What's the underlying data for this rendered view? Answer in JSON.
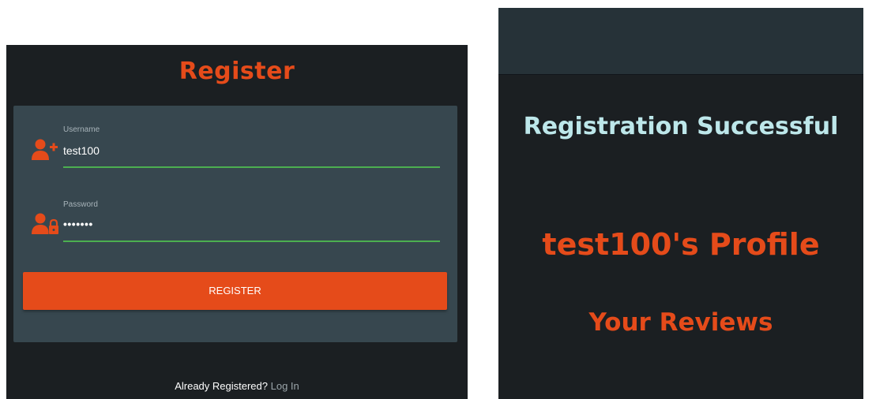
{
  "register": {
    "title": "Register",
    "username": {
      "label": "Username",
      "value": "test100",
      "icon": "add-user-icon"
    },
    "password": {
      "label": "Password",
      "value": "•••••••",
      "icon": "user-lock-icon"
    },
    "button_label": "REGISTER",
    "login_prompt": "Already Registered?",
    "login_link": "Log In"
  },
  "success": {
    "heading": "Registration Successful",
    "profile_heading": "test100's Profile",
    "reviews_heading": "Your Reviews"
  },
  "colors": {
    "accent": "#e54b1a",
    "field_underline": "#4caf50",
    "success_text": "#bde7ea",
    "panel_bg": "#1b1f22",
    "card_bg": "#37474f"
  }
}
